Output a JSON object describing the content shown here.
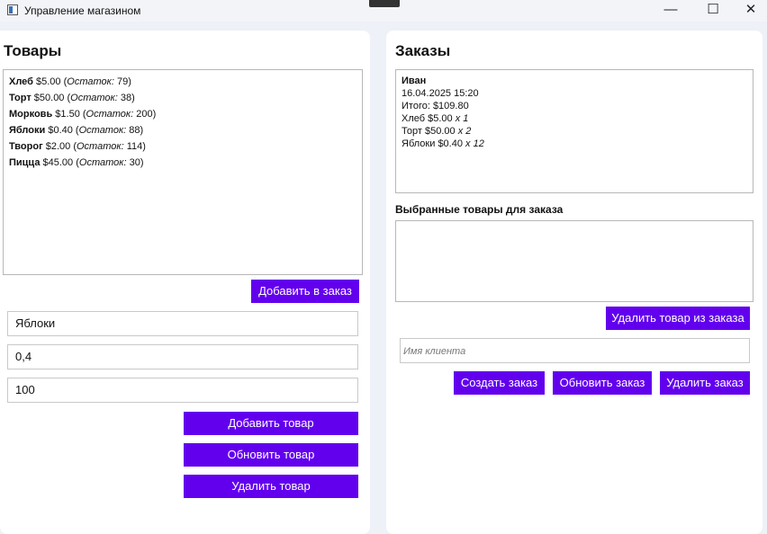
{
  "window": {
    "title": "Управление магазином",
    "minimize": "—",
    "maximize": "☐",
    "close": "✕"
  },
  "products": {
    "heading": "Товары",
    "items": [
      {
        "name": "Хлеб",
        "price": "$5.00",
        "stock_label": "Остаток:",
        "stock": "79"
      },
      {
        "name": "Торт",
        "price": "$50.00",
        "stock_label": "Остаток:",
        "stock": "38"
      },
      {
        "name": "Морковь",
        "price": "$1.50",
        "stock_label": "Остаток:",
        "stock": "200"
      },
      {
        "name": "Яблоки",
        "price": "$0.40",
        "stock_label": "Остаток:",
        "stock": "88"
      },
      {
        "name": "Творог",
        "price": "$2.00",
        "stock_label": "Остаток:",
        "stock": "114"
      },
      {
        "name": "Пицца",
        "price": "$45.00",
        "stock_label": "Остаток:",
        "stock": "30"
      }
    ],
    "add_to_order_button": "Добавить в заказ",
    "name_value": "Яблоки",
    "price_value": "0,4",
    "quantity_value": "100",
    "add_button": "Добавить товар",
    "update_button": "Обновить товар",
    "delete_button": "Удалить товар"
  },
  "orders": {
    "heading": "Заказы",
    "order": {
      "customer": "Иван",
      "date": "16.04.2025 15:20",
      "total": "Итого: $109.80",
      "lines": [
        {
          "name": "Хлеб",
          "price": "$5.00",
          "qty": "x 1"
        },
        {
          "name": "Торт",
          "price": "$50.00",
          "qty": "x 2"
        },
        {
          "name": "Яблоки",
          "price": "$0.40",
          "qty": "x 12"
        }
      ]
    },
    "selected_heading": "Выбранные товары для заказа",
    "remove_item_button": "Удалить товар из заказа",
    "customer_placeholder": "Имя клиента",
    "create_button": "Создать заказ",
    "update_button": "Обновить заказ",
    "delete_button": "Удалить заказ"
  }
}
